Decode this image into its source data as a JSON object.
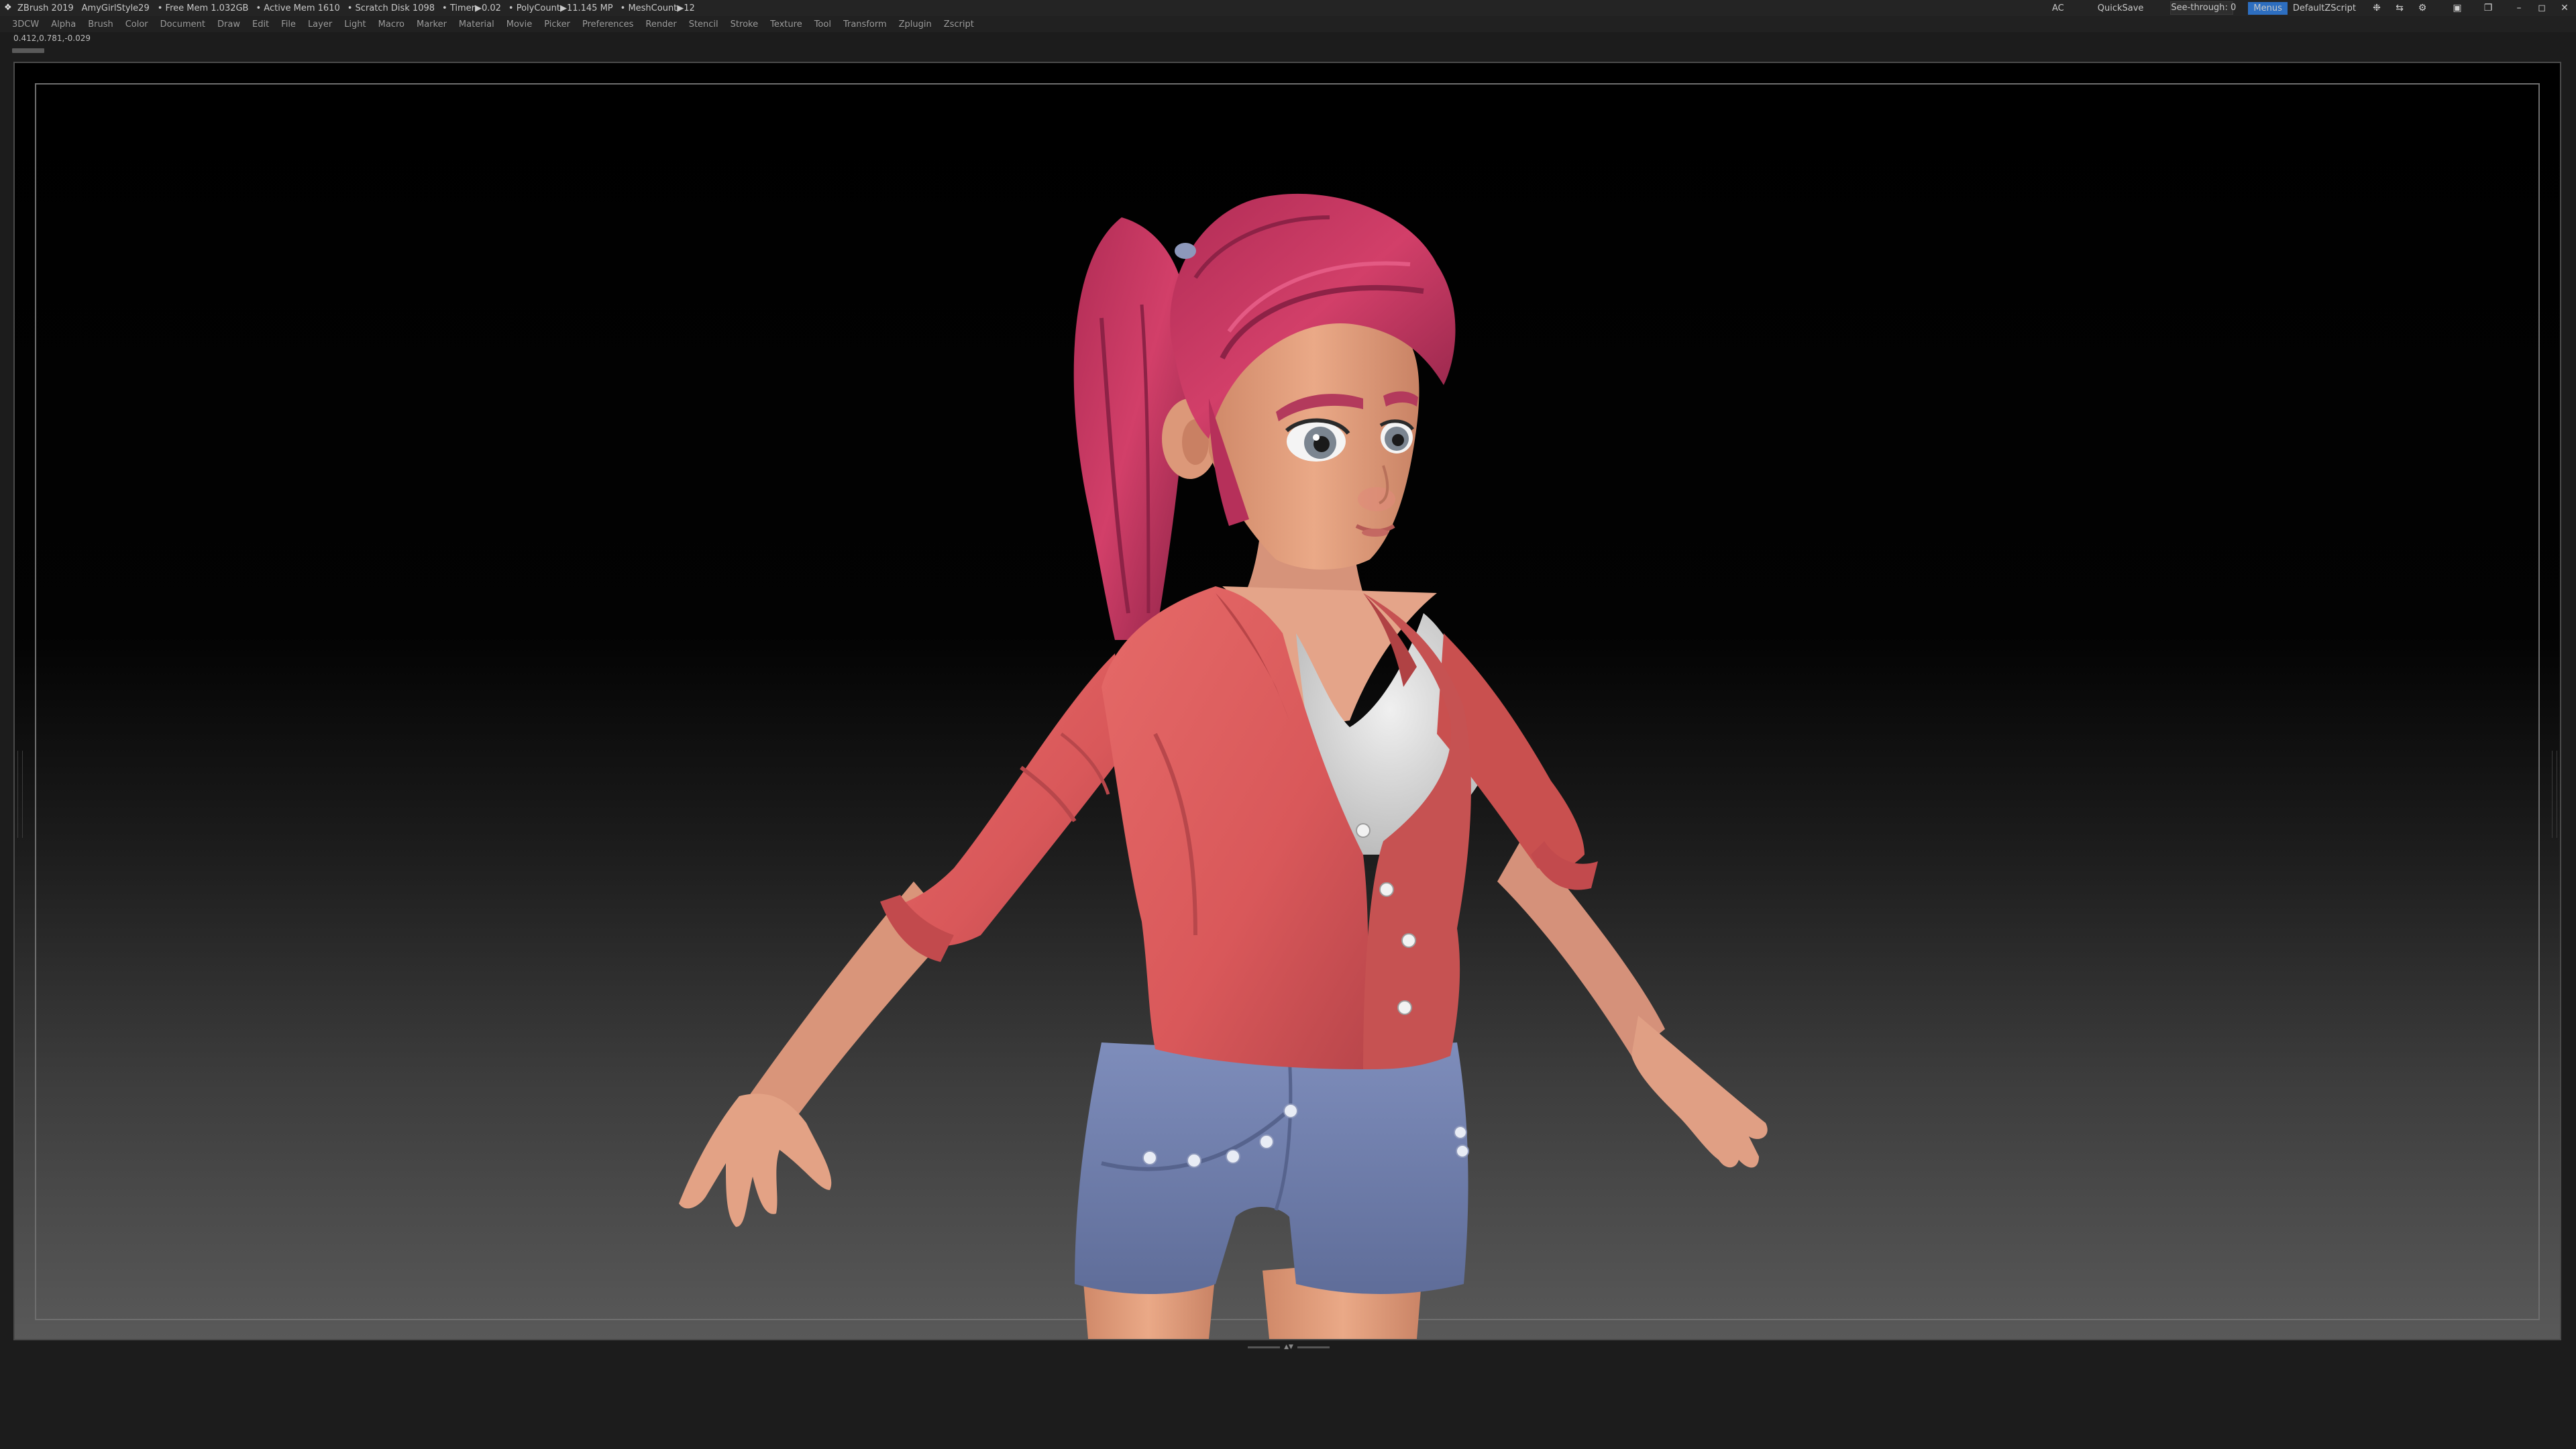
{
  "title_bar": {
    "app": "ZBrush 2019",
    "document": "AmyGirlStyle29",
    "stats": [
      "• Free Mem 1.032GB",
      "• Active Mem 1610",
      "• Scratch Disk 1098",
      "• Timer▶0.02",
      "• PolyCount▶11.145 MP",
      "• MeshCount▶12"
    ],
    "ac_label": "AC",
    "quicksave": "QuickSave",
    "see_through_label": "See-through",
    "see_through_value": "0",
    "see_through_fraction": 0.0,
    "menus_label": "Menus",
    "script_label": "DefaultZScript",
    "icons": [
      "palette-icon",
      "flip-icon",
      "settings-icon",
      "lock-icon",
      "restore-icon",
      "minimize-icon",
      "maximize-icon",
      "close-icon"
    ],
    "icon_glyphs": [
      "❉",
      "⇆",
      "⚙",
      "▣",
      "❐",
      "–",
      "◻",
      "✕"
    ]
  },
  "menu_bar": {
    "items": [
      "3DCW",
      "Alpha",
      "Brush",
      "Color",
      "Document",
      "Draw",
      "Edit",
      "File",
      "Layer",
      "Light",
      "Macro",
      "Marker",
      "Material",
      "Movie",
      "Picker",
      "Preferences",
      "Render",
      "Stencil",
      "Stroke",
      "Texture",
      "Tool",
      "Transform",
      "Zplugin",
      "Zscript"
    ]
  },
  "coordinates": "0.412,0.781,-0.029",
  "colors": {
    "hair": "#c4385e",
    "skin": "#e4a07c",
    "jacket": "#df5f5e",
    "tank_top": "#e2e2e2",
    "shorts": "#7080ad",
    "eyes": "#7b8590",
    "accent_menus": "#2d6ec0"
  }
}
